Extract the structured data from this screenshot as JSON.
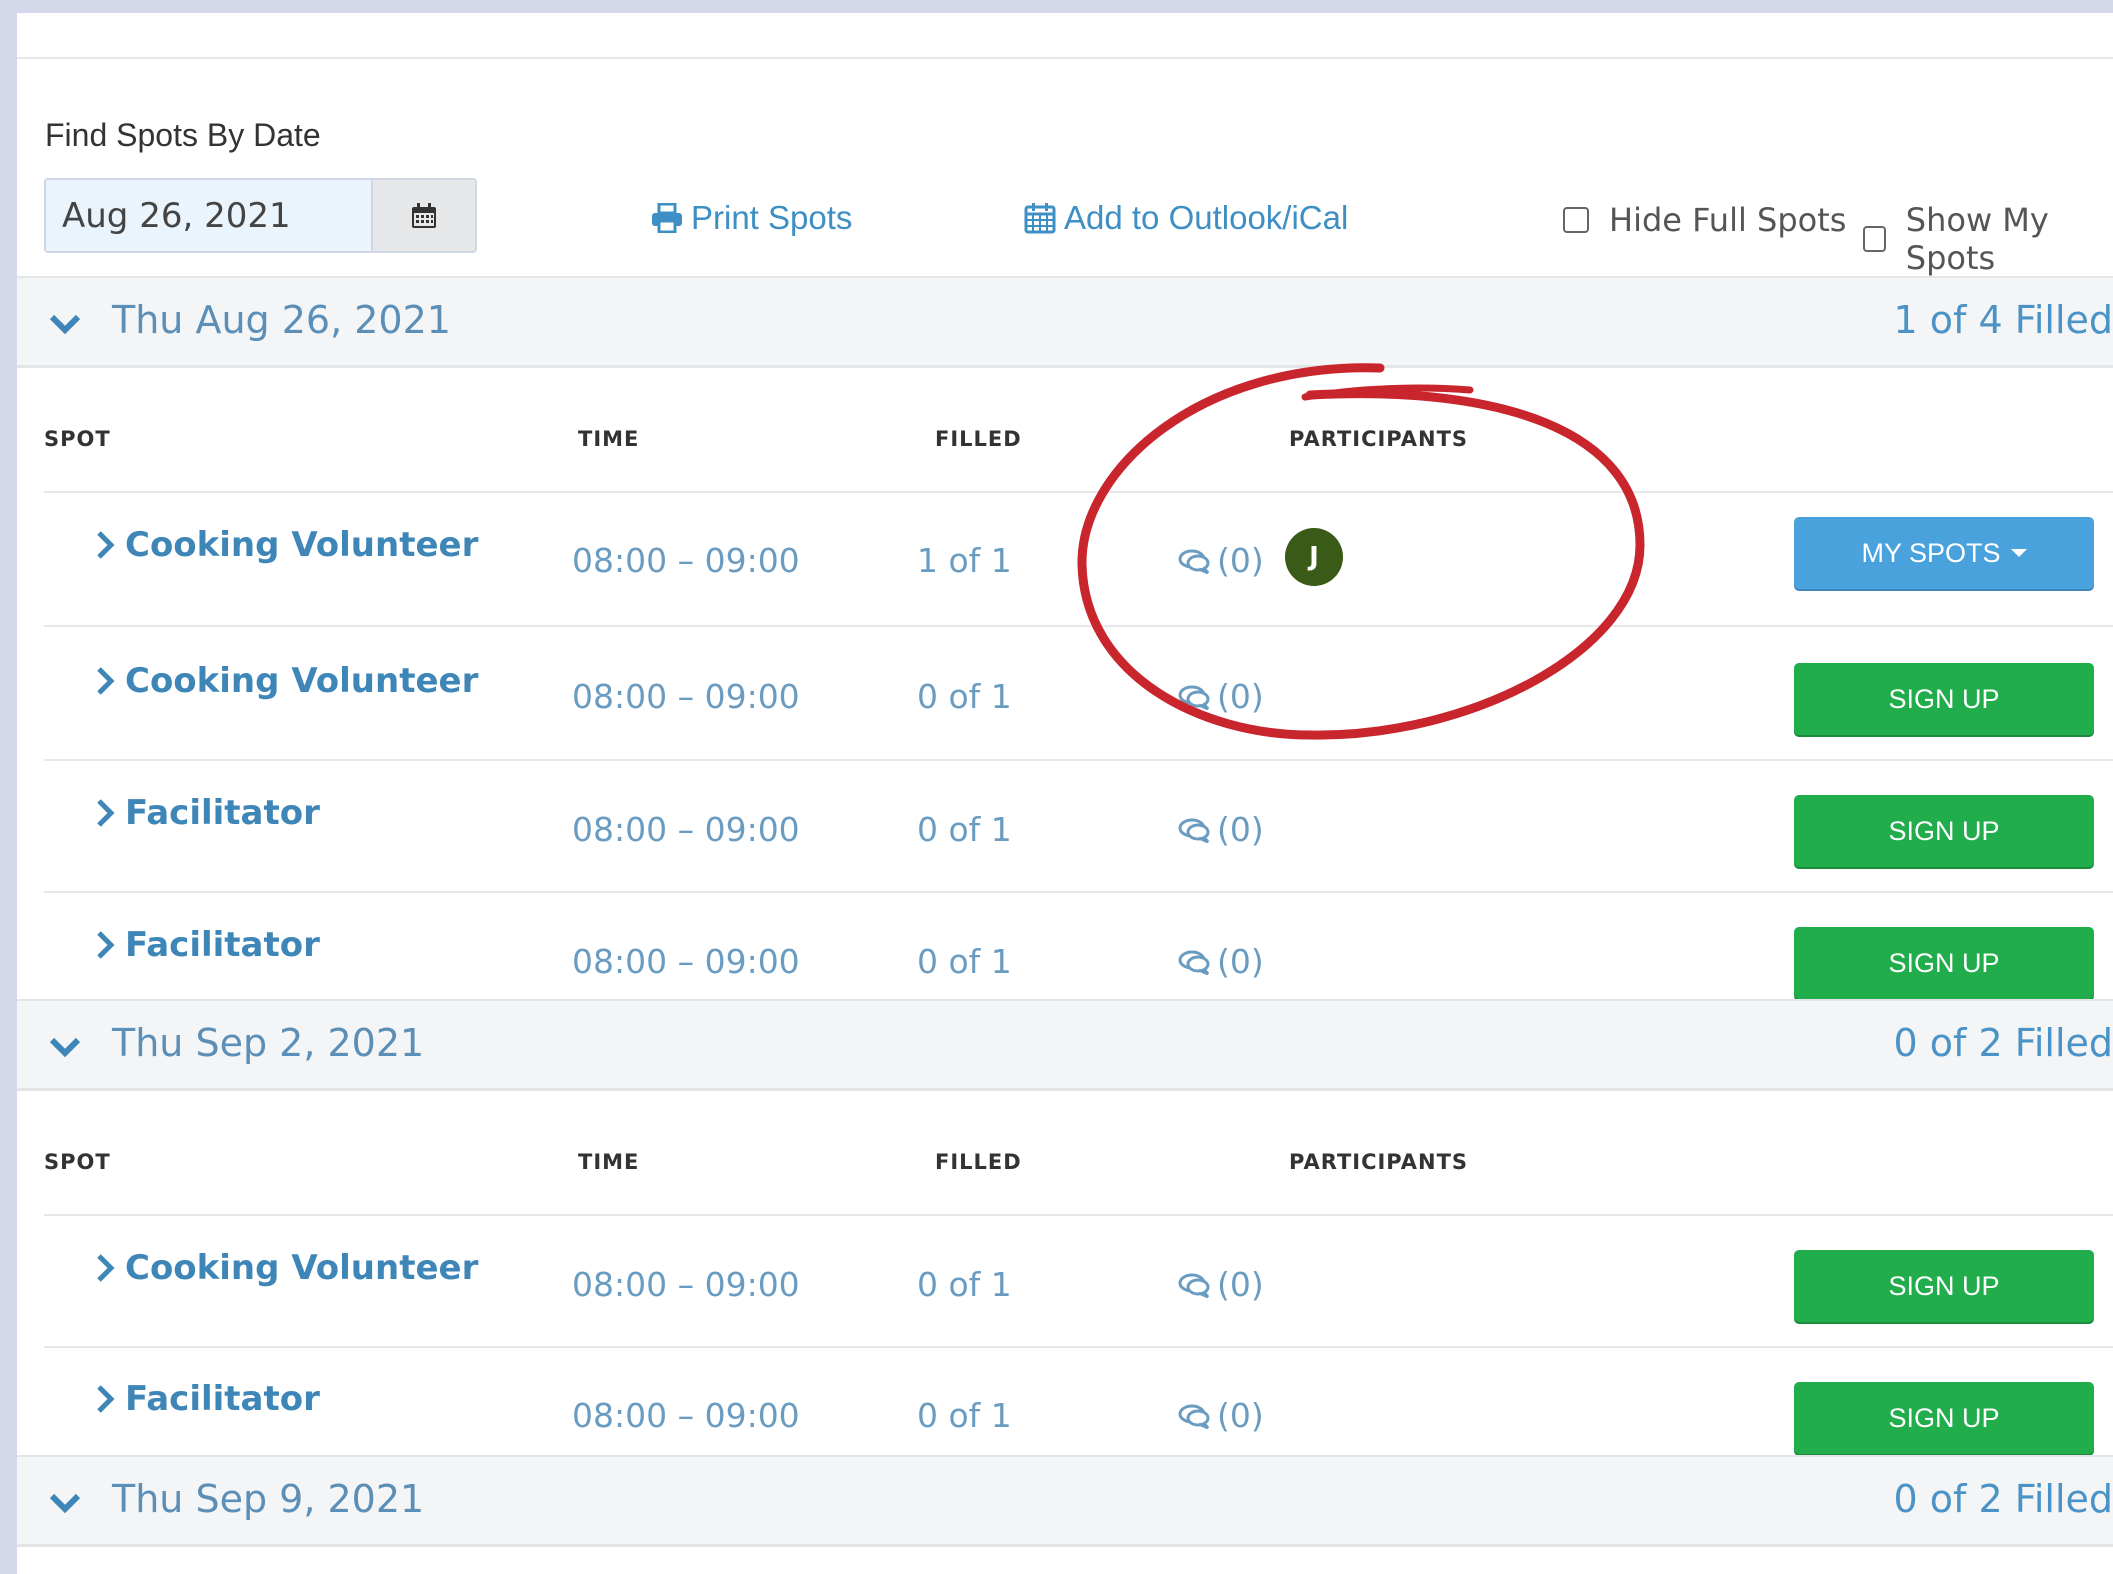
{
  "find": {
    "label": "Find Spots By Date",
    "date_value": "Aug 26, 2021"
  },
  "toolbar": {
    "print_label": "Print Spots",
    "calendar_label": "Add to Outlook/iCal",
    "hide_full_label": "Hide Full Spots",
    "show_mine_label": "Show My Spots"
  },
  "columns": {
    "spot": "SPOT",
    "time": "TIME",
    "filled": "FILLED",
    "participants": "PARTICIPANTS"
  },
  "dates": [
    {
      "title": "Thu Aug 26, 2021",
      "count": "1 of 4 Filled",
      "rows": [
        {
          "spot": "Cooking Volunteer",
          "time": "08:00 – 09:00",
          "filled": "1 of 1",
          "comments": "(0)",
          "participant": "J",
          "button": "MY SPOTS"
        },
        {
          "spot": "Cooking Volunteer",
          "time": "08:00 – 09:00",
          "filled": "0 of 1",
          "comments": "(0)",
          "button": "SIGN UP"
        },
        {
          "spot": "Facilitator",
          "time": "08:00 – 09:00",
          "filled": "0 of 1",
          "comments": "(0)",
          "button": "SIGN UP"
        },
        {
          "spot": "Facilitator",
          "time": "08:00 – 09:00",
          "filled": "0 of 1",
          "comments": "(0)",
          "button": "SIGN UP"
        }
      ]
    },
    {
      "title": "Thu Sep 2, 2021",
      "count": "0 of 2 Filled",
      "rows": [
        {
          "spot": "Cooking Volunteer",
          "time": "08:00 – 09:00",
          "filled": "0 of 1",
          "comments": "(0)",
          "button": "SIGN UP"
        },
        {
          "spot": "Facilitator",
          "time": "08:00 – 09:00",
          "filled": "0 of 1",
          "comments": "(0)",
          "button": "SIGN UP"
        }
      ]
    },
    {
      "title": "Thu Sep 9, 2021",
      "count": "0 of 2 Filled"
    }
  ],
  "colors": {
    "link_blue": "#3f86b8",
    "sign_up_green": "#21ad4b",
    "my_spots_blue": "#4aa2dd",
    "annotation_red": "#c9252c"
  },
  "icons": [
    "calendar-icon",
    "printer-icon",
    "calendar-add-icon",
    "chevron-down-icon",
    "chevron-right-icon",
    "comment-icon"
  ]
}
